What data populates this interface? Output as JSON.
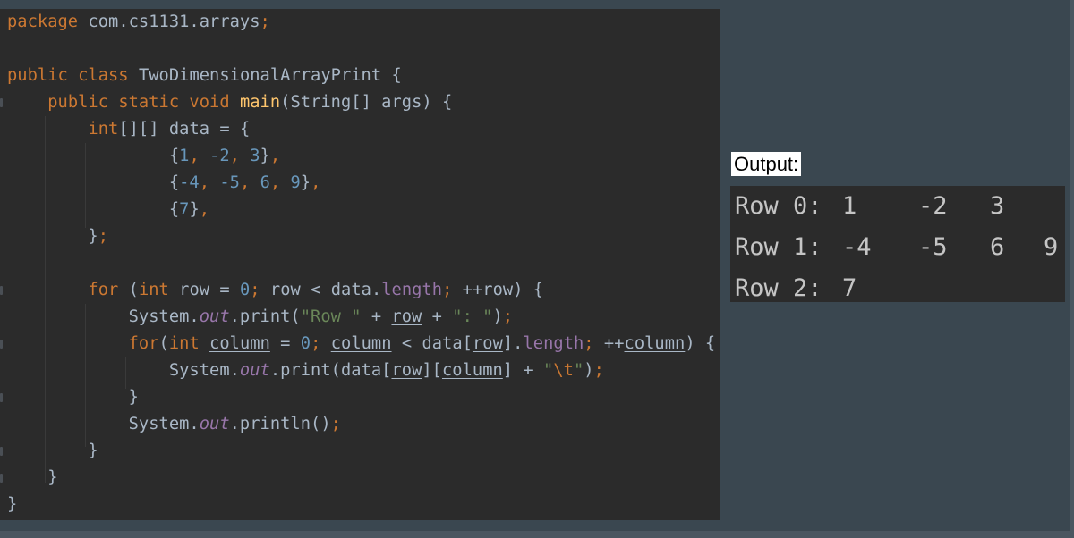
{
  "code": {
    "package_kw": "package",
    "package_name": "com.cs1131.arrays",
    "class_name": "TwoDimensionalArrayPrint",
    "main_name": "main",
    "data_var": "data",
    "array_rows": [
      [
        "1",
        "-2",
        "3"
      ],
      [
        "-4",
        "-5",
        "6",
        "9"
      ],
      [
        "7"
      ]
    ],
    "row_var": "row",
    "column_var": "column",
    "row_string": "\"Row \"",
    "colon_string": "\": \"",
    "tab_string_open": "\"",
    "tab_escape": "\\t",
    "tab_string_close": "\"",
    "zero": "0"
  },
  "output": {
    "label": "Output:",
    "rows": [
      {
        "prefix": "Row 0:",
        "values": [
          "1",
          "-2",
          "3"
        ]
      },
      {
        "prefix": "Row 1:",
        "values": [
          "-4",
          "-5",
          "6",
          "9"
        ]
      },
      {
        "prefix": "Row 2:",
        "values": [
          "7"
        ]
      }
    ]
  }
}
